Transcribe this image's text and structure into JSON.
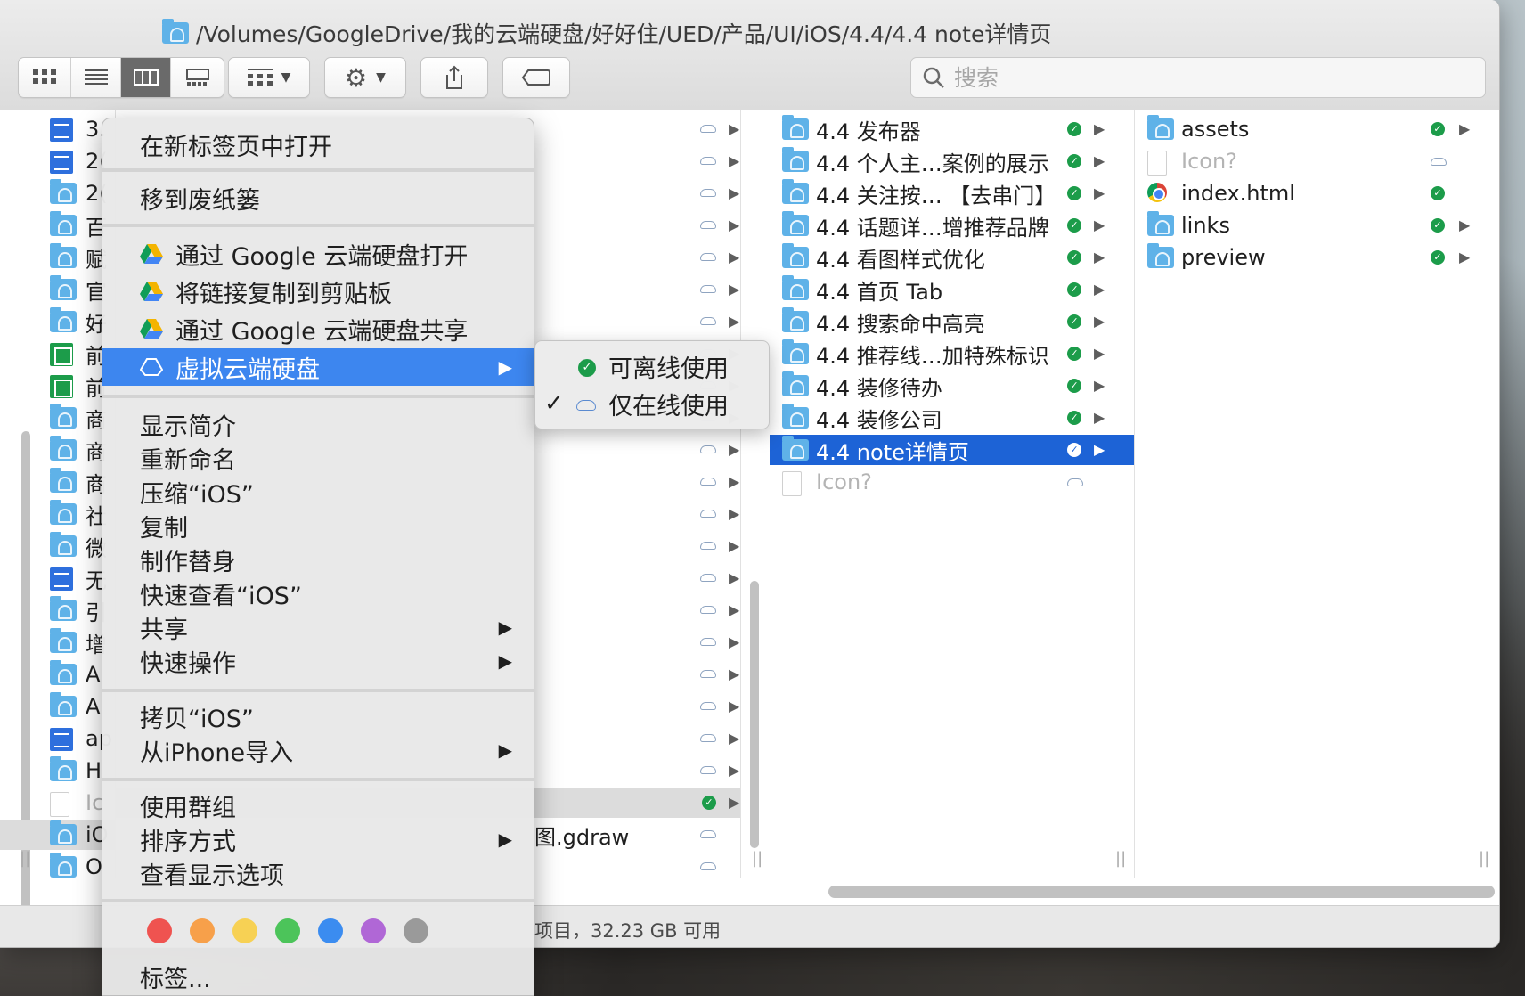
{
  "window": {
    "path_title": "/Volumes/GoogleDrive/我的云端硬盘/好好住/UED/产品/UI/iOS/4.4/4.4 note详情页"
  },
  "search": {
    "placeholder": "搜索"
  },
  "column1": {
    "items": [
      {
        "icon": "doc",
        "label": "3.",
        "y": 0
      },
      {
        "icon": "doc",
        "label": "2(",
        "y": 1
      },
      {
        "icon": "folder",
        "label": "2(",
        "y": 2
      },
      {
        "icon": "folder",
        "label": "百",
        "y": 3
      },
      {
        "icon": "folder",
        "label": "赋",
        "y": 4
      },
      {
        "icon": "folder",
        "label": "官",
        "y": 5
      },
      {
        "icon": "folder",
        "label": "好",
        "y": 6
      },
      {
        "icon": "sheet",
        "label": "前",
        "y": 7
      },
      {
        "icon": "sheet",
        "label": "前",
        "y": 8
      },
      {
        "icon": "folder",
        "label": "商",
        "y": 9
      },
      {
        "icon": "folder",
        "label": "商",
        "y": 10
      },
      {
        "icon": "folder",
        "label": "商",
        "y": 11
      },
      {
        "icon": "folder",
        "label": "社",
        "y": 12
      },
      {
        "icon": "folder",
        "label": "微",
        "y": 13
      },
      {
        "icon": "doc",
        "label": "无",
        "y": 14
      },
      {
        "icon": "folder",
        "label": "引",
        "y": 15
      },
      {
        "icon": "folder",
        "label": "增",
        "y": 16
      },
      {
        "icon": "folder",
        "label": "A",
        "y": 17
      },
      {
        "icon": "folder",
        "label": "A",
        "y": 18
      },
      {
        "icon": "doc",
        "label": "ap",
        "y": 19
      },
      {
        "icon": "folder",
        "label": "H",
        "y": 20
      },
      {
        "icon": "blank",
        "label": "Ic",
        "y": 21
      },
      {
        "icon": "folder",
        "label": "iO",
        "y": 22
      },
      {
        "icon": "folder",
        "label": "O",
        "y": 23
      }
    ]
  },
  "column2": {
    "partial_label": "图.gdraw"
  },
  "column3": {
    "items": [
      {
        "label": "4.4 发布器"
      },
      {
        "label": "4.4 个人主…案例的展示"
      },
      {
        "label": "4.4 关注按… 【去串门】"
      },
      {
        "label": "4.4 话题详…增推荐品牌"
      },
      {
        "label": "4.4 看图样式优化"
      },
      {
        "label": "4.4 首页 Tab"
      },
      {
        "label": "4.4 搜索命中高亮"
      },
      {
        "label": "4.4 推荐线…加特殊标识"
      },
      {
        "label": "4.4 装修待办"
      },
      {
        "label": "4.4 装修公司"
      },
      {
        "label": "4.4 note详情页"
      },
      {
        "label": "Icon?"
      }
    ]
  },
  "column4": {
    "items": [
      {
        "label": "assets"
      },
      {
        "label": "Icon?"
      },
      {
        "label": "index.html"
      },
      {
        "label": "links"
      },
      {
        "label": "preview"
      }
    ]
  },
  "statusbar": {
    "text": "项目，32.23 GB 可用"
  },
  "context_menu": {
    "open_in_new_tab": "在新标签页中打开",
    "move_to_trash": "移到废纸篓",
    "open_with_drive": "通过 Google 云端硬盘打开",
    "copy_link": "将链接复制到剪贴板",
    "share_with_drive": "通过 Google 云端硬盘共享",
    "virtual_drive": "虚拟云端硬盘",
    "get_info": "显示简介",
    "rename": "重新命名",
    "compress": "压缩“iOS”",
    "duplicate": "复制",
    "make_alias": "制作替身",
    "quick_look": "快速查看“iOS”",
    "share": "共享",
    "quick_actions": "快速操作",
    "copy_item": "拷贝“iOS”",
    "import_from_iphone": "从iPhone导入",
    "use_groups": "使用群组",
    "sort_by": "排序方式",
    "view_options": "查看显示选项",
    "tags": "标签...",
    "tag_colors": [
      "#ef5350",
      "#f7a04a",
      "#f7d154",
      "#4cc45a",
      "#3b8cf0",
      "#b067d6",
      "#9a9a9a"
    ]
  },
  "submenu": {
    "offline": "可离线使用",
    "online_only": "仅在线使用",
    "checkmark": "✓"
  },
  "colors": {
    "selection_blue": "#1d63d6",
    "menu_highlight": "#3d86ef",
    "sync_green": "#1c9c4a"
  }
}
